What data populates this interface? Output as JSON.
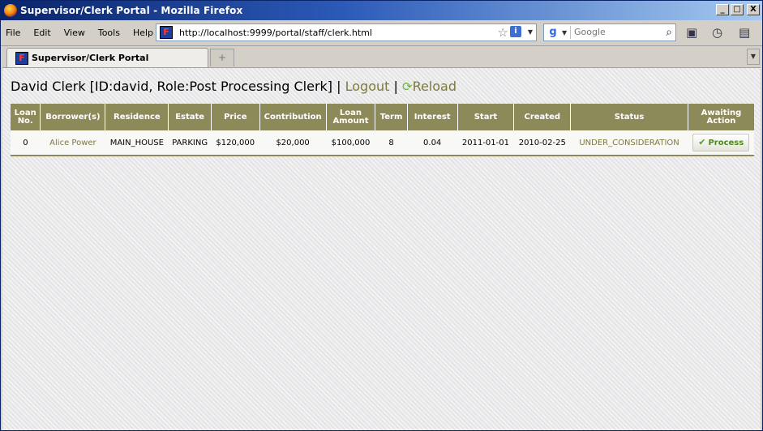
{
  "window": {
    "title": "Supervisor/Clerk Portal - Mozilla Firefox",
    "buttons": {
      "minimize": "_",
      "maximize": "□",
      "close": "X"
    }
  },
  "menu": {
    "items": [
      "File",
      "Edit",
      "View",
      "Tools",
      "Help"
    ]
  },
  "address_bar": {
    "url": "http://localhost:9999/portal/staff/clerk.html"
  },
  "search": {
    "placeholder": "Google"
  },
  "tabs": [
    {
      "label": "Supervisor/Clerk Portal"
    }
  ],
  "page": {
    "user_info": "David Clerk [ID:david, Role:Post Processing Clerk]",
    "separator": "|",
    "logout_label": "Logout",
    "reload_label": "Reload"
  },
  "table": {
    "headers": [
      "Loan No.",
      "Borrower(s)",
      "Residence",
      "Estate",
      "Price",
      "Contribution",
      "Loan Amount",
      "Term",
      "Interest",
      "Start",
      "Created",
      "Status",
      "Awaiting Action"
    ],
    "rows": [
      {
        "loan_no": "0",
        "borrower": "Alice Power",
        "residence": "MAIN_HOUSE",
        "estate": "PARKING",
        "price": "$120,000",
        "contribution": "$20,000",
        "loan_amount": "$100,000",
        "term": "8",
        "interest": "0.04",
        "start": "2011-01-01",
        "created": "2010-02-25",
        "status": "UNDER_CONSIDERATION",
        "action_label": "Process"
      }
    ]
  },
  "colors": {
    "header_bg": "#8d8a5a",
    "link": "#7d7a3c",
    "action_text": "#4e8a1c",
    "title_bar": "#0a246a"
  },
  "icons": {
    "browser": "firefox-icon",
    "site": "site-favicon",
    "bookmark_star": "star-icon",
    "site_info": "info-icon",
    "search_engine": "google-icon",
    "search_go": "magnifier-icon",
    "reload": "reload-icon",
    "check": "check-icon"
  }
}
